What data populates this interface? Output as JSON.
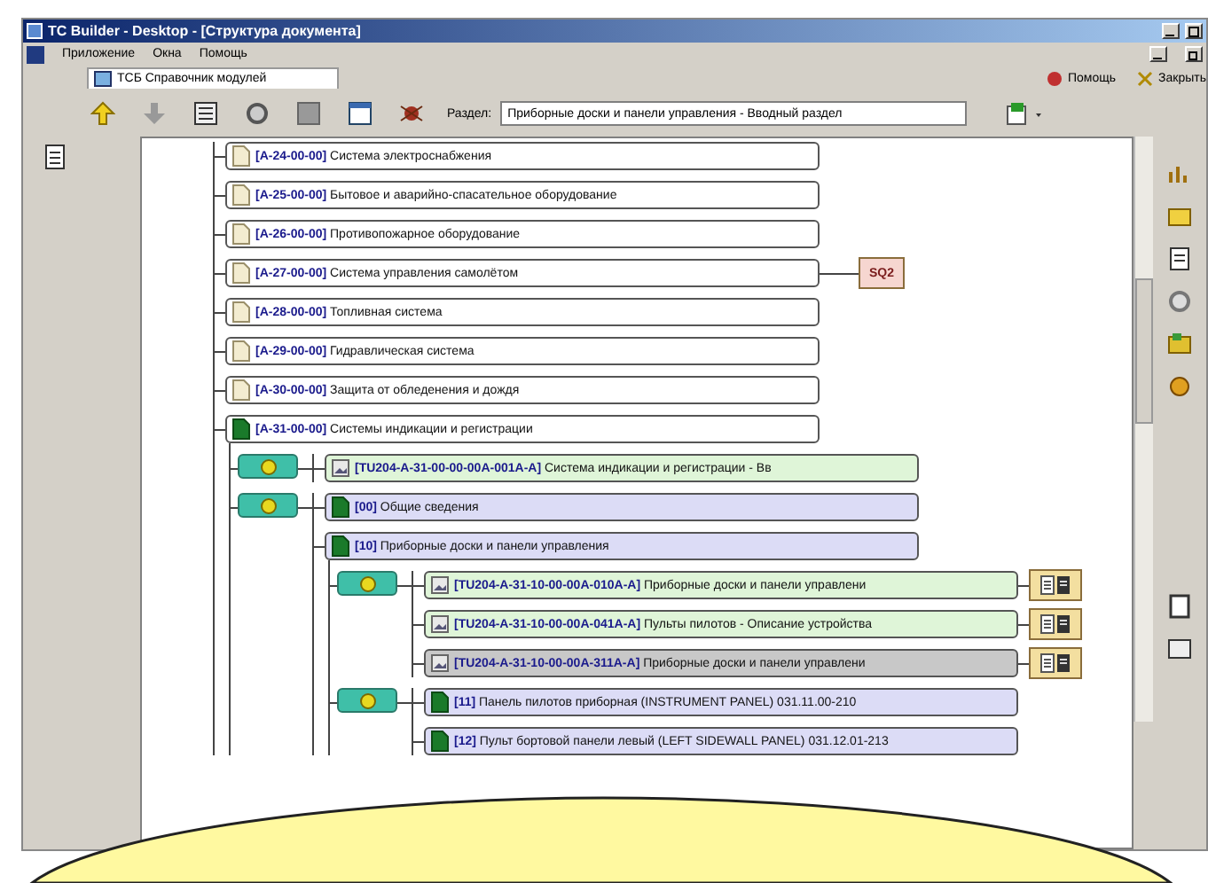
{
  "window": {
    "title": "TC Builder - Desktop - [Структура документа]"
  },
  "menu": [
    "Приложение",
    "Окна",
    "Помощь"
  ],
  "tab": {
    "label": "ТСБ Справочник модулей"
  },
  "top_links": [
    "Помощь",
    "Закрыть"
  ],
  "toolbar": {
    "section_label": "Раздел:",
    "section_value": "Приборные доски и панели управления - Вводный раздел"
  },
  "tree": [
    {
      "kind": "section",
      "label": "**[A-24-00-00]** Система электроснабжения",
      "expanded": false
    },
    {
      "kind": "section",
      "label": "**[A-25-00-00]** Бытовое и аварийно-спасательное оборудование",
      "expanded": false
    },
    {
      "kind": "section",
      "label": "**[A-26-00-00]** Противопожарное оборудование",
      "expanded": false
    },
    {
      "kind": "section",
      "label": "**[A-27-00-00]** Система управления самолётом",
      "expanded": false,
      "badge": "SQ2"
    },
    {
      "kind": "section",
      "label": "**[A-28-00-00]** Топливная система",
      "expanded": false
    },
    {
      "kind": "section",
      "label": "**[A-29-00-00]** Гидравлическая система",
      "expanded": false
    },
    {
      "kind": "section",
      "label": "**[A-30-00-00]** Защита от обледенения и дождя",
      "expanded": false
    },
    {
      "kind": "section",
      "label": "**[A-31-00-00]** Системы индикации и регистрации",
      "expanded": true,
      "children": [
        {
          "kind": "module",
          "items": [
            {
              "kind": "doc",
              "label": "**[TU204-A-31-00-00-00A-001A-A]** Система индикации и регистрации - Вв",
              "disabled": false,
              "attachment": false
            }
          ]
        },
        {
          "kind": "module",
          "items": [
            {
              "kind": "group",
              "label": "**[00]** Общие сведения"
            },
            {
              "kind": "group",
              "label": "**[10]** Приборные доски и панели управления",
              "children": [
                {
                  "kind": "module",
                  "items": [
                    {
                      "kind": "doc",
                      "label": "**[TU204-A-31-10-00-00A-010A-A]** Приборные доски и панели управлени",
                      "disabled": false,
                      "attachment": true
                    },
                    {
                      "kind": "doc",
                      "label": "**[TU204-A-31-10-00-00A-041A-A]** Пульты пилотов - Описание устройства",
                      "disabled": false,
                      "attachment": true
                    },
                    {
                      "kind": "doc",
                      "label": "**[TU204-A-31-10-00-00A-311A-A]** Приборные доски и панели управлени",
                      "disabled": true,
                      "attachment": true
                    }
                  ]
                },
                {
                  "kind": "module",
                  "items": [
                    {
                      "kind": "group",
                      "label": "**[11]** Панель пилотов приборная (INSTRUMENT PANEL) 031.11.00-210"
                    },
                    {
                      "kind": "group",
                      "label": "**[12]** Пульт бортовой панели левый (LEFT SIDEWALL PANEL) 031.12.01-213"
                    }
                  ]
                }
              ]
            }
          ]
        }
      ]
    }
  ]
}
